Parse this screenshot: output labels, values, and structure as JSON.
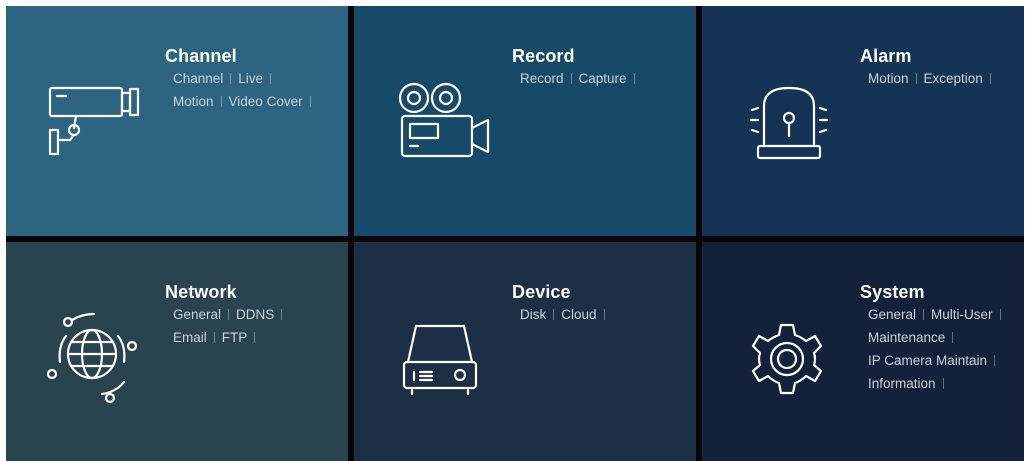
{
  "colors": {
    "channel_bg": "#2c6482",
    "record_bg": "#174a68",
    "alarm_bg": "#153355",
    "network_bg": "#29434f",
    "device_bg": "#1c2f45",
    "system_bg": "#14213a",
    "divider": "#050607"
  },
  "tiles": {
    "channel": {
      "title": "Channel",
      "icon": "security-camera-icon",
      "items": [
        "Channel",
        "Live",
        "Motion",
        "Video Cover"
      ]
    },
    "record": {
      "title": "Record",
      "icon": "film-camera-icon",
      "items": [
        "Record",
        "Capture"
      ]
    },
    "alarm": {
      "title": "Alarm",
      "icon": "siren-icon",
      "items": [
        "Motion",
        "Exception"
      ]
    },
    "network": {
      "title": "Network",
      "icon": "globe-network-icon",
      "items": [
        "General",
        "DDNS",
        "Email",
        "FTP"
      ]
    },
    "device": {
      "title": "Device",
      "icon": "hard-drive-icon",
      "items": [
        "Disk",
        "Cloud"
      ]
    },
    "system": {
      "title": "System",
      "icon": "gear-icon",
      "items": [
        "General",
        "Multi-User",
        "Maintenance",
        "IP Camera Maintain",
        "Information"
      ]
    }
  }
}
